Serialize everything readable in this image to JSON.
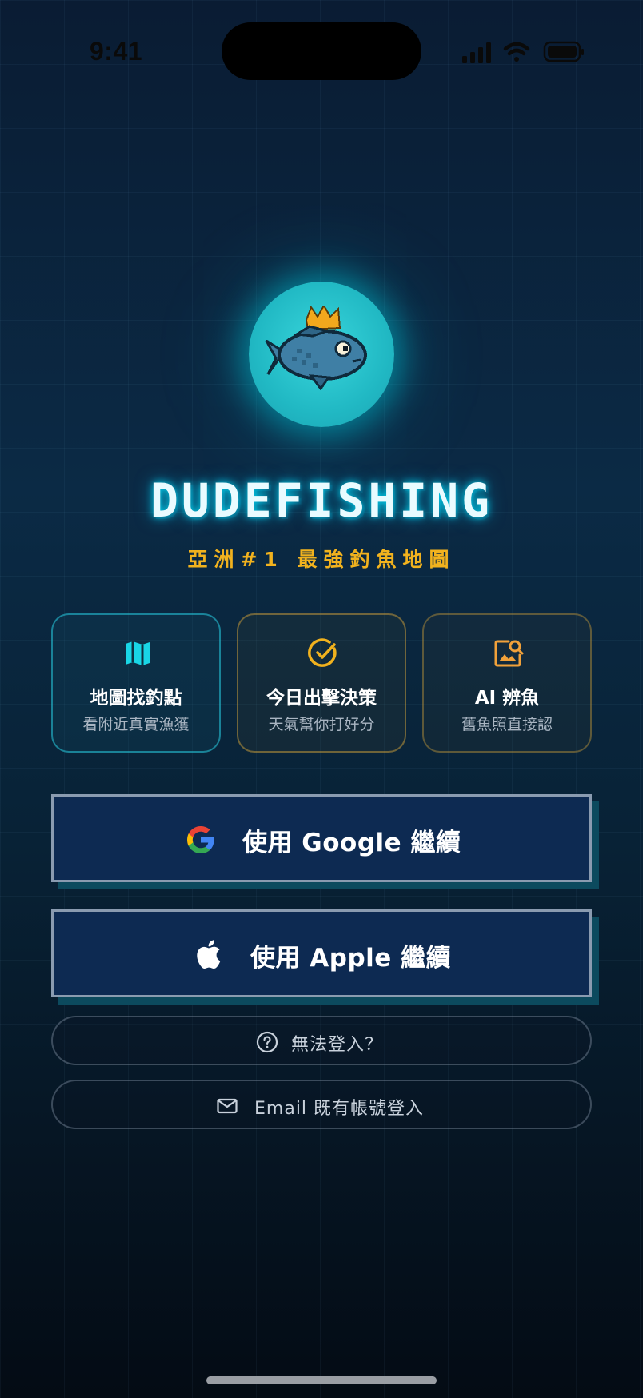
{
  "status_bar": {
    "time": "9:41",
    "icons": [
      "signal-icon",
      "wifi-icon",
      "battery-icon"
    ]
  },
  "logo": {
    "icon": "crowned-fish-icon"
  },
  "app": {
    "title": "DUDEFISHING",
    "tagline": "亞洲#1 最強釣魚地圖"
  },
  "features": [
    {
      "icon": "map-icon",
      "title": "地圖找釣點",
      "subtitle": "看附近真實漁獲",
      "accent": "#19d6e6"
    },
    {
      "icon": "check-circle-icon",
      "title": "今日出擊決策",
      "subtitle": "天氣幫你打好分",
      "accent": "#f1b21e"
    },
    {
      "icon": "image-search-icon",
      "title": "AI 辨魚",
      "subtitle": "舊魚照直接認",
      "accent": "#f1a13a"
    }
  ],
  "buttons": {
    "google": {
      "label": "使用 Google 繼續",
      "icon": "google-icon"
    },
    "apple": {
      "label": "使用 Apple 繼續",
      "icon": "apple-icon"
    },
    "help": {
      "label": "無法登入？",
      "icon": "question-circle-icon"
    },
    "email": {
      "label": "Email 既有帳號登入",
      "icon": "mail-icon"
    }
  },
  "colors": {
    "background_top": "#0a1c33",
    "background_bottom": "#040b14",
    "title_glow": "#00e6ff",
    "tagline": "#f1b21e",
    "button_fill": "#0d2a52",
    "button_border": "#8a9bb0",
    "button_shadow": "#0c4a5e"
  }
}
